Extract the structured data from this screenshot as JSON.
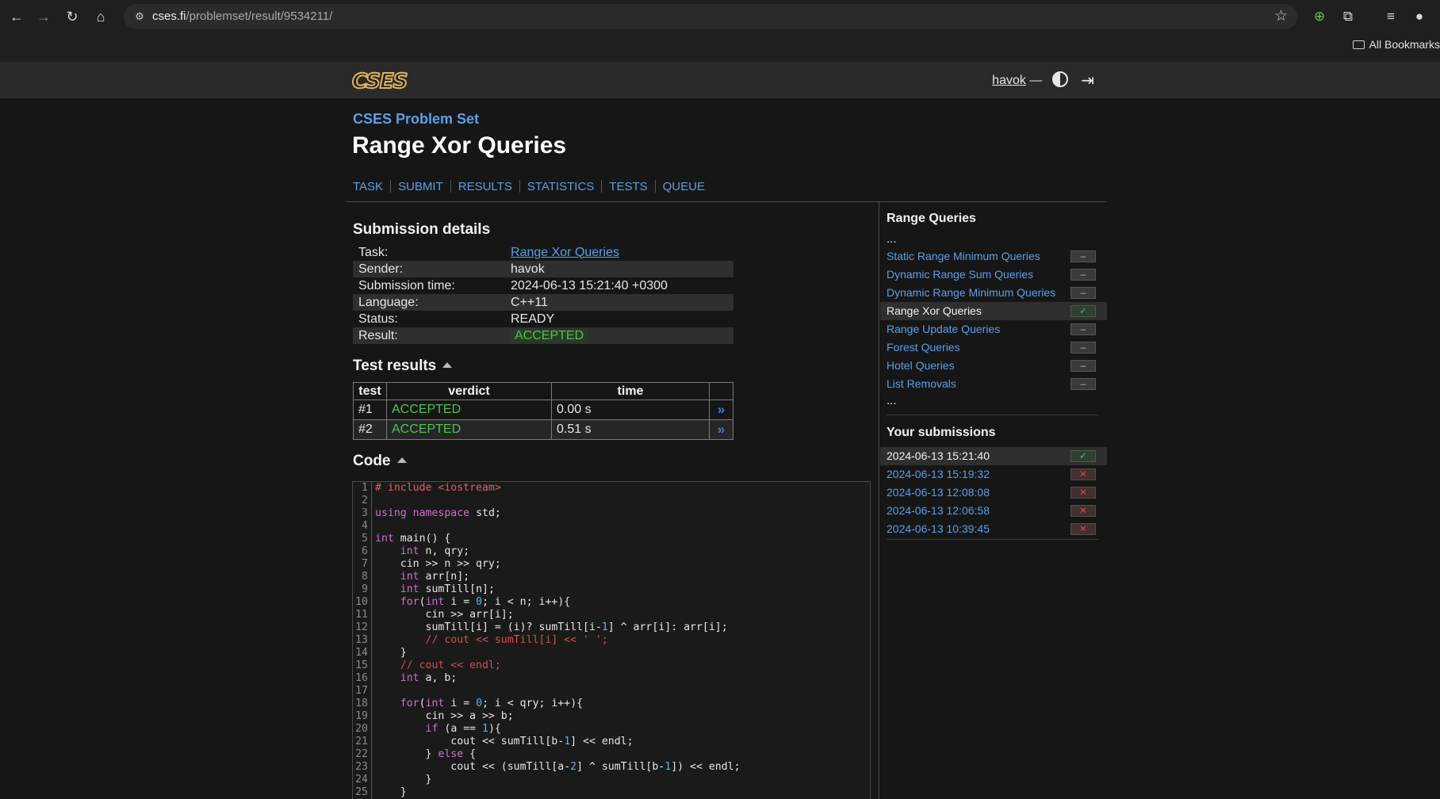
{
  "browser": {
    "url_host": "cses.fi",
    "url_path": "/problemset/result/9534211/",
    "bookmarks_label": "All Bookmarks"
  },
  "header": {
    "logo_text": "CSES",
    "username": "havok",
    "dash": "—"
  },
  "page": {
    "problemset_label": "CSES Problem Set",
    "title": "Range Xor Queries",
    "tabs": [
      "TASK",
      "SUBMIT",
      "RESULTS",
      "STATISTICS",
      "TESTS",
      "QUEUE"
    ]
  },
  "submission": {
    "heading": "Submission details",
    "rows": [
      {
        "key": "Task:",
        "value": "Range Xor Queries"
      },
      {
        "key": "Sender:",
        "value": "havok"
      },
      {
        "key": "Submission time:",
        "value": "2024-06-13 15:21:40 +0300"
      },
      {
        "key": "Language:",
        "value": "C++11"
      },
      {
        "key": "Status:",
        "value": "READY"
      },
      {
        "key": "Result:",
        "value": "ACCEPTED"
      }
    ]
  },
  "tests": {
    "heading": "Test results",
    "columns": [
      "test",
      "verdict",
      "time"
    ],
    "rows": [
      {
        "test": "#1",
        "verdict": "ACCEPTED",
        "time": "0.00 s"
      },
      {
        "test": "#2",
        "verdict": "ACCEPTED",
        "time": "0.51 s"
      }
    ]
  },
  "code": {
    "heading": "Code"
  },
  "sidebar": {
    "category_title": "Range Queries",
    "ellipsis": "...",
    "tasks": [
      {
        "label": "Static Range Minimum Queries",
        "status": "–"
      },
      {
        "label": "Dynamic Range Sum Queries",
        "status": "–"
      },
      {
        "label": "Dynamic Range Minimum Queries",
        "status": "–"
      },
      {
        "label": "Range Xor Queries",
        "status": "✓"
      },
      {
        "label": "Range Update Queries",
        "status": "–"
      },
      {
        "label": "Forest Queries",
        "status": "–"
      },
      {
        "label": "Hotel Queries",
        "status": "–"
      },
      {
        "label": "List Removals",
        "status": "–"
      }
    ],
    "submissions_title": "Your submissions",
    "submissions": [
      {
        "time": "2024-06-13 15:21:40",
        "status": "✓"
      },
      {
        "time": "2024-06-13 15:19:32",
        "status": "✕"
      },
      {
        "time": "2024-06-13 12:08:08",
        "status": "✕"
      },
      {
        "time": "2024-06-13 12:06:58",
        "status": "✕"
      },
      {
        "time": "2024-06-13 10:39:45",
        "status": "✕"
      }
    ]
  }
}
